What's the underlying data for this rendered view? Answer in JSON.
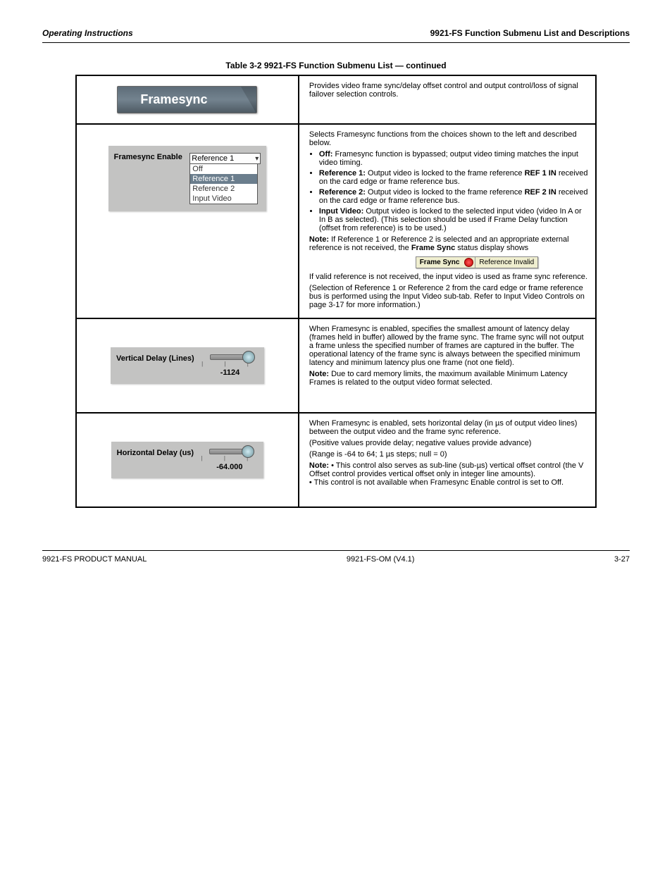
{
  "header": {
    "left": "Operating Instructions",
    "right": "9921-FS Function Submenu List and Descriptions"
  },
  "table_caption": "Table 3-2  9921-FS Function Submenu List — continued",
  "rows": {
    "r0": {
      "badge": "Framesync",
      "right": "Provides video frame sync/delay offset control and output control/loss of signal failover selection controls."
    },
    "r1": {
      "panel_label": "Framesync Enable",
      "select_value": "Reference 1",
      "options": {
        "o0": "Off",
        "o1": "Reference 1",
        "o2": "Reference 2",
        "o3": "Input Video"
      },
      "status": {
        "label": "Frame Sync",
        "text": "Reference Invalid"
      },
      "right_html": {
        "intro": "Selects Framesync functions from the choices shown to the left and described below.",
        "li0a": "Off:",
        "li0b": " Framesync function is bypassed; output video timing matches the input video timing.",
        "li1a": "Reference 1:",
        "li1b": " Output video is locked to the frame reference ",
        "li1c": "REF 1 IN",
        "li1d": " received on the card edge or frame reference bus.",
        "li2a": "Reference 2:",
        "li2b": " Output video is locked to the frame reference ",
        "li2c": "REF 2 IN",
        "li2d": " received on the card edge or frame reference bus.",
        "li3a": "Input Video:",
        "li3b": " Output video is locked to the selected input video (video In A or In B as selected). (This selection should be used if Frame Delay function (offset from reference) is to be used.)",
        "note_label": "Note: ",
        "note_body": "If Reference 1 or Reference 2 is selected and an appropriate external reference is not received, the ",
        "note_bold1": "Frame Sync",
        "note_body2": " status display shows ",
        "note_status": "Reference Invalid",
        "tail1": "If valid reference is not received, the input video is used as frame sync reference.",
        "tail2": "(Selection of Reference 1 or Reference 2 from the card edge or frame reference bus is performed using the Input Video sub-tab. Refer to Input Video Controls on page 3-17 for more information.)"
      }
    },
    "r2": {
      "panel_label": "Vertical Delay (Lines)",
      "value": "-1124",
      "right": {
        "p1": "When Framesync is enabled, specifies the smallest amount of latency delay (frames held in buffer) allowed by the frame sync. The frame sync will not output a frame unless the specified number of frames are captured in the buffer. The operational latency of the frame sync is always between the specified minimum latency and minimum latency plus one frame (not one field).",
        "note_label": "Note: ",
        "note_body": "Due to card memory limits, the maximum available Minimum Latency Frames is related to the output video format selected."
      }
    },
    "r3": {
      "panel_label": "Horizontal Delay (us)",
      "value": "-64.000",
      "right": {
        "p1": "When Framesync is enabled, sets horizontal delay (in µs of output video lines) between the output video and the frame sync reference.",
        "p2": "(Positive values provide delay; negative values provide advance)",
        "p3": "(Range is -64 to 64; 1 µs steps; null = 0)",
        "note_label": "Note: ",
        "note_body1": "• This control also serves as sub-line (sub-µs) vertical offset control (the V Offset control provides vertical offset only in integer line amounts).",
        "note_body2": "• This control is not available when Framesync Enable control is set to Off."
      }
    }
  },
  "footer": {
    "left": "9921-FS PRODUCT MANUAL",
    "mid": "9921-FS-OM (V4.1)",
    "right": "3-27"
  }
}
